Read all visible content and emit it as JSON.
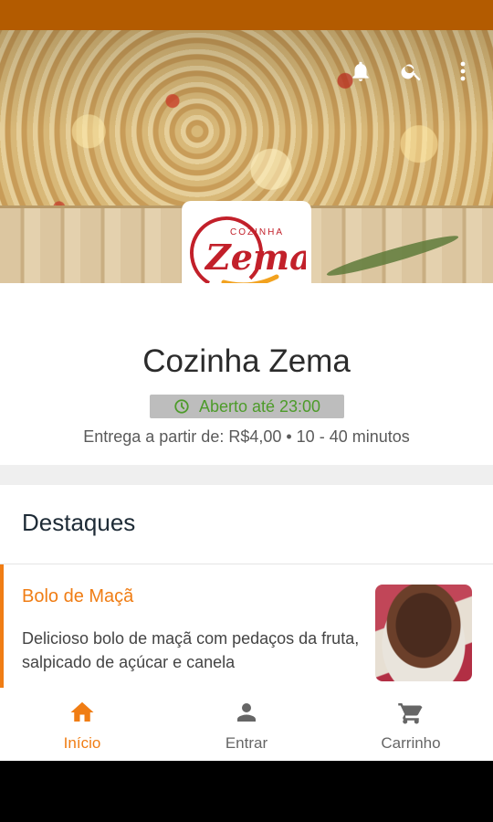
{
  "colors": {
    "status_bar": "#b35b00",
    "accent": "#f07d14",
    "open_green": "#4d9b2a",
    "badge_bg": "#bdbdbd"
  },
  "header": {
    "icons": [
      "bell-icon",
      "search-icon",
      "more-vert-icon"
    ]
  },
  "logo": {
    "top_text": "COZINHA",
    "main_text": "Zema"
  },
  "store": {
    "name": "Cozinha Zema",
    "status": "Aberto até 23:00",
    "delivery": "Entrega a partir de: R$4,00 • 10 - 40 minutos"
  },
  "highlights": {
    "title": "Destaques",
    "items": [
      {
        "name": "Bolo de Maçã",
        "description": "Delicioso bolo de maçã com pedaços da fruta, salpicado de açúcar e canela"
      }
    ]
  },
  "nav": {
    "items": [
      {
        "label": "Início",
        "icon": "home-icon",
        "active": true
      },
      {
        "label": "Entrar",
        "icon": "person-icon",
        "active": false
      },
      {
        "label": "Carrinho",
        "icon": "cart-icon",
        "active": false
      }
    ]
  }
}
